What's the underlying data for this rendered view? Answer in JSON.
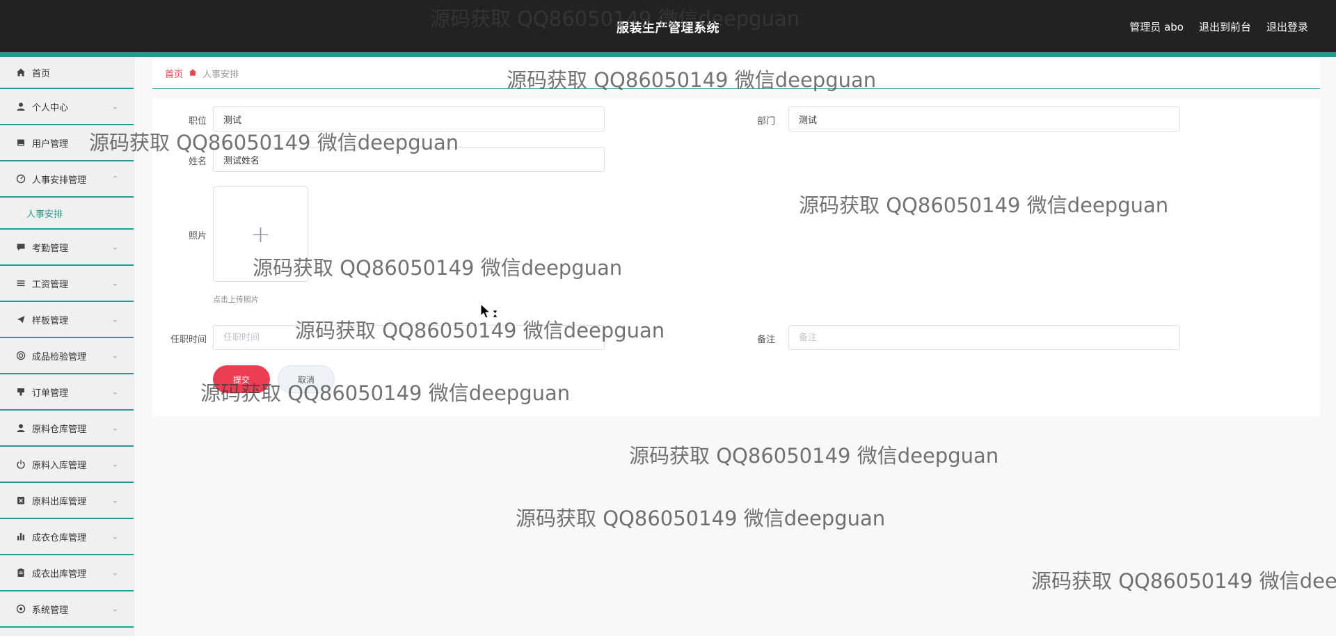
{
  "header": {
    "title": "服装生产管理系统",
    "user_label": "管理员 abo",
    "front_label": "退出到前台",
    "logout_label": "退出登录"
  },
  "sidebar": {
    "items": [
      {
        "label": "首页",
        "icon": "home-icon",
        "has_chevron": false
      },
      {
        "label": "个人中心",
        "icon": "user-icon",
        "has_chevron": true
      },
      {
        "label": "用户管理",
        "icon": "book-icon",
        "has_chevron": false
      },
      {
        "label": "人事安排管理",
        "icon": "gauge-icon",
        "has_chevron": true,
        "expanded": true
      },
      {
        "label": "考勤管理",
        "icon": "chat-icon",
        "has_chevron": true
      },
      {
        "label": "工资管理",
        "icon": "list-icon",
        "has_chevron": true
      },
      {
        "label": "样板管理",
        "icon": "send-icon",
        "has_chevron": true
      },
      {
        "label": "成品检验管理",
        "icon": "target-icon",
        "has_chevron": true
      },
      {
        "label": "订单管理",
        "icon": "stamp-icon",
        "has_chevron": true
      },
      {
        "label": "原料仓库管理",
        "icon": "person-icon",
        "has_chevron": true
      },
      {
        "label": "原料入库管理",
        "icon": "power-icon",
        "has_chevron": true
      },
      {
        "label": "原料出库管理",
        "icon": "box-icon",
        "has_chevron": true
      },
      {
        "label": "成衣仓库管理",
        "icon": "bar-chart-icon",
        "has_chevron": true
      },
      {
        "label": "成衣出库管理",
        "icon": "clipboard-icon",
        "has_chevron": true
      },
      {
        "label": "系统管理",
        "icon": "settings-icon",
        "has_chevron": true
      }
    ],
    "sub_item": "人事安排"
  },
  "breadcrumb": {
    "home": "首页",
    "current": "人事安排"
  },
  "form": {
    "position_label": "职位",
    "position_value": "测试",
    "department_label": "部门",
    "department_value": "测试",
    "name_label": "姓名",
    "name_value": "测试姓名",
    "photo_label": "照片",
    "upload_tip": "点击上传照片",
    "tenure_label": "任职时间",
    "tenure_placeholder": "任职时间",
    "remark_label": "备注",
    "remark_placeholder": "备注",
    "submit_label": "提交",
    "cancel_label": "取消"
  },
  "watermark": {
    "text": "源码获取 QQ86050149 微信deepguan"
  },
  "colors": {
    "header_bg": "#222222",
    "accent": "#1f9c8c",
    "submit": "#ec3d52"
  }
}
